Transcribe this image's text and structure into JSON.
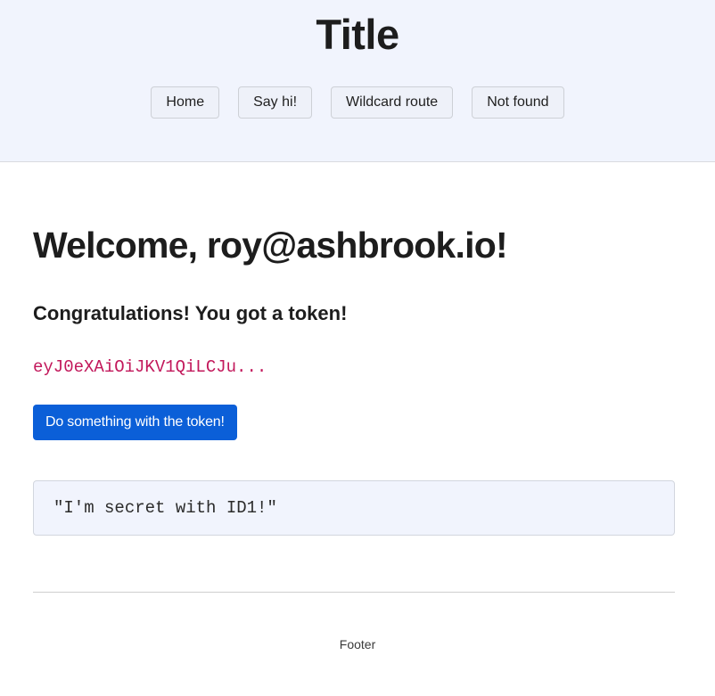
{
  "header": {
    "title": "Title",
    "nav": [
      {
        "label": "Home"
      },
      {
        "label": "Say hi!"
      },
      {
        "label": "Wildcard route"
      },
      {
        "label": "Not found"
      }
    ]
  },
  "main": {
    "welcome": "Welcome, roy@ashbrook.io!",
    "congrats": "Congratulations! You got a token!",
    "token": "eyJ0eXAiOiJKV1QiLCJu...",
    "action_button": "Do something with the token!",
    "secret": "\"I'm secret with ID1!\""
  },
  "footer": {
    "text": "Footer"
  },
  "colors": {
    "header_bg": "#f1f4fd",
    "primary_button": "#0b5fd8",
    "token_text": "#c2185b"
  }
}
